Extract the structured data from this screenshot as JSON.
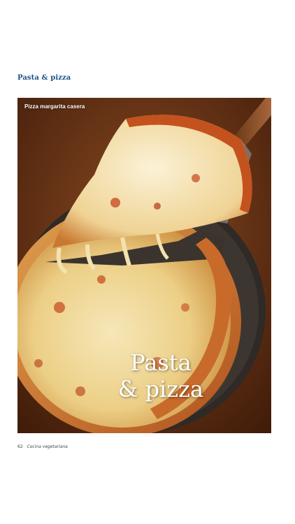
{
  "page": {
    "section_title": "Pasta & pizza",
    "photo_caption": "Pizza margarita casera",
    "overlay_title_line1": "Pasta",
    "overlay_title_line2": "& pizza",
    "footer_page_number": "62",
    "footer_magazine": "Cocina vegetariana"
  },
  "colors": {
    "section_title": "#1d4f86",
    "background": "#ffffff"
  }
}
